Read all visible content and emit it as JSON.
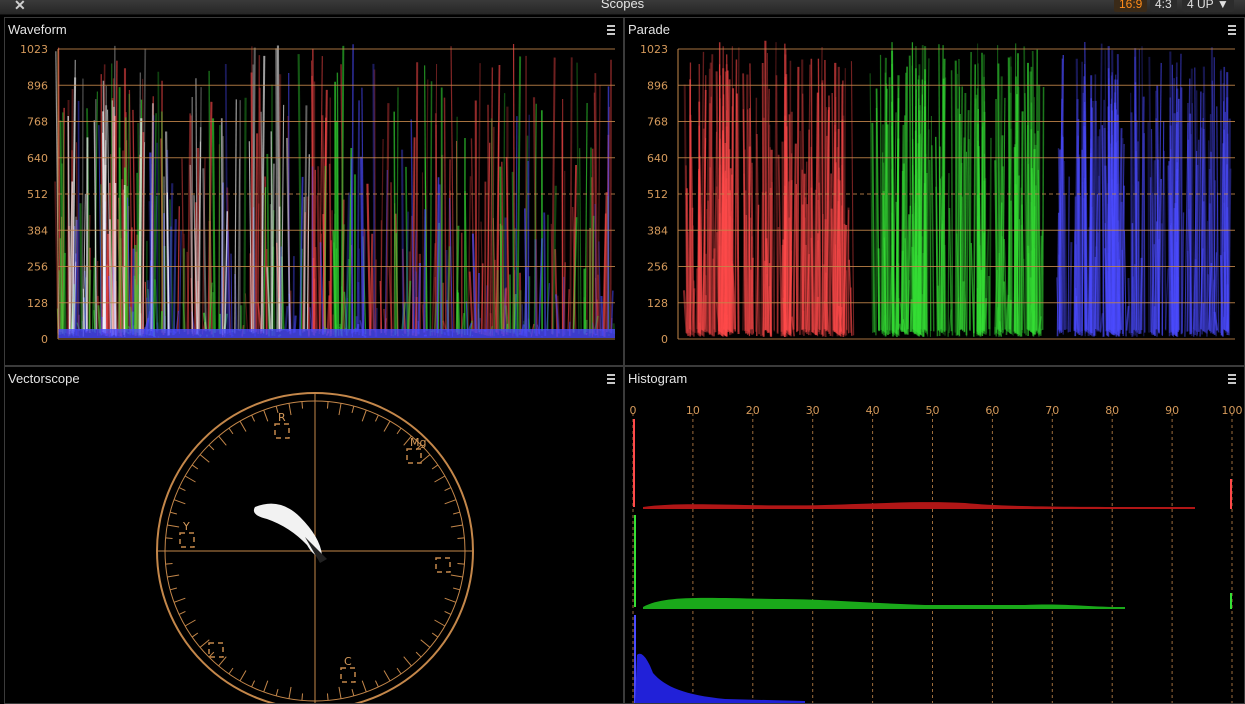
{
  "window": {
    "title": "Scopes",
    "close_icon": "close-icon"
  },
  "toolbar": {
    "aspect_169": "16:9",
    "aspect_43": "4:3",
    "layout_label": "4 UP",
    "layout_icon": "chevron-down-icon",
    "active_color": "#ff8c1a"
  },
  "waveform": {
    "title": "Waveform",
    "menu_icon": "hamburger-icon",
    "scale": [
      "1023",
      "896",
      "768",
      "640",
      "512",
      "384",
      "256",
      "128",
      "0"
    ]
  },
  "parade": {
    "title": "Parade",
    "menu_icon": "hamburger-icon",
    "scale": [
      "1023",
      "896",
      "768",
      "640",
      "512",
      "384",
      "256",
      "128",
      "0"
    ],
    "channels": [
      "red",
      "green",
      "blue"
    ]
  },
  "vectorscope": {
    "title": "Vectorscope",
    "menu_icon": "hamburger-icon",
    "targets": [
      "R",
      "Mg",
      "B",
      "C",
      "G",
      "Yl"
    ],
    "visible_target_labels": {
      "r": "R",
      "mg": "Mg",
      "c": "C",
      "yl": "Y"
    }
  },
  "histogram": {
    "title": "Histogram",
    "menu_icon": "hamburger-icon",
    "scale": [
      "0",
      "10",
      "20",
      "30",
      "40",
      "50",
      "60",
      "70",
      "80",
      "90",
      "100"
    ],
    "channels": [
      "red",
      "green",
      "blue"
    ]
  },
  "colors": {
    "graticule": "#c4874a",
    "red": "#ff4a4a",
    "green": "#35e035",
    "blue": "#4b4bff",
    "panel_border": "#3b3b3b"
  }
}
